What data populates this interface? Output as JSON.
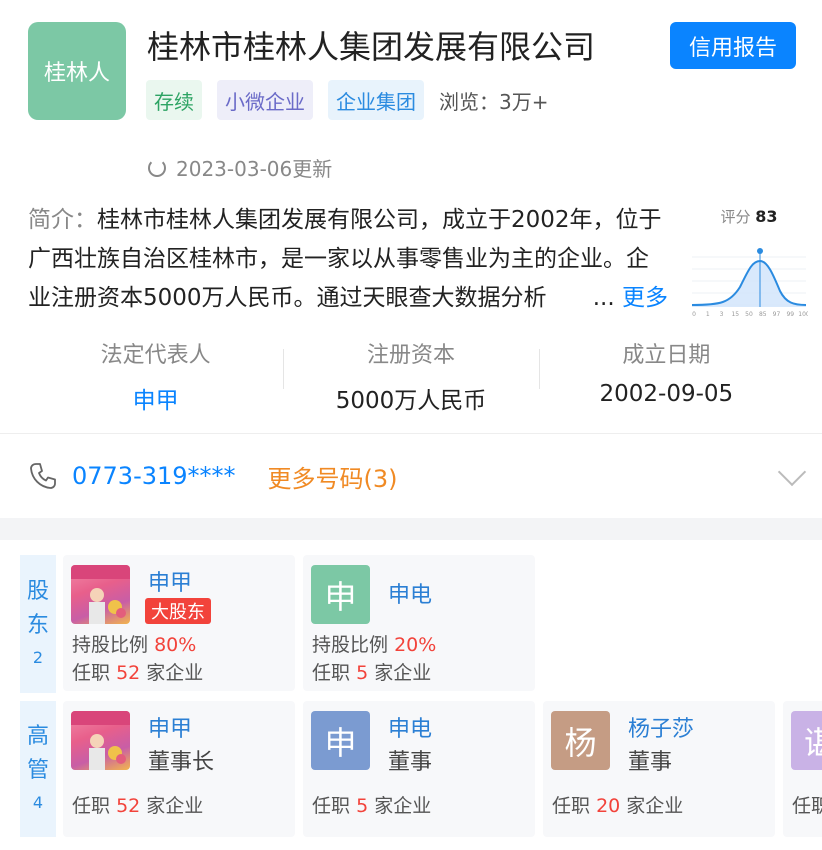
{
  "company": {
    "logo_text": "桂林人",
    "name": "桂林市桂林人集团发展有限公司",
    "report_button": "信用报告",
    "tags": [
      "存续",
      "小微企业",
      "企业集团"
    ],
    "views_label": "浏览：3万+",
    "updated": "2023-03-06更新"
  },
  "intro": {
    "label": "简介：",
    "text": "桂林市桂林人集团发展有限公司，成立于2002年，位于广西壮族自治区桂林市，是一家以从事零售业为主的企业。企业注册资本5000万人民币。通过天眼查大数据分析",
    "ellipsis": "...",
    "more": "更多"
  },
  "score": {
    "label": "评分",
    "value": "83",
    "axis_ticks": [
      "0",
      "1",
      "3",
      "15",
      "50",
      "85",
      "97",
      "99",
      "100"
    ]
  },
  "stats": [
    {
      "label": "法定代表人",
      "value": "申甲"
    },
    {
      "label": "注册资本",
      "value": "5000万人民币"
    },
    {
      "label": "成立日期",
      "value": "2002-09-05"
    }
  ],
  "phone": {
    "number": "0773-319****",
    "more": "更多号码(3)"
  },
  "shareholders": {
    "label": [
      "股",
      "东"
    ],
    "count": "2",
    "items": [
      {
        "avatar": "",
        "name": "申甲",
        "badge": "大股东",
        "ratio_label": "持股比例",
        "ratio": "80%",
        "jobs_prefix": "任职",
        "jobs": "52",
        "jobs_suffix": "家企业"
      },
      {
        "avatar": "申",
        "name": "申电",
        "ratio_label": "持股比例",
        "ratio": "20%",
        "jobs_prefix": "任职",
        "jobs": "5",
        "jobs_suffix": "家企业"
      }
    ]
  },
  "executives": {
    "label": [
      "高",
      "管"
    ],
    "count": "4",
    "items": [
      {
        "avatar": "",
        "name": "申甲",
        "role": "董事长",
        "jobs_prefix": "任职",
        "jobs": "52",
        "jobs_suffix": "家企业"
      },
      {
        "avatar": "申",
        "name": "申电",
        "role": "董事",
        "jobs_prefix": "任职",
        "jobs": "5",
        "jobs_suffix": "家企业"
      },
      {
        "avatar": "杨",
        "name": "杨子莎",
        "role": "董事",
        "jobs_prefix": "任职",
        "jobs": "20",
        "jobs_suffix": "家企业"
      },
      {
        "avatar": "谌",
        "jobs_prefix": "任职"
      }
    ]
  },
  "colors": {
    "primary": "#0a84ff",
    "accent_orange": "#f08a24",
    "red": "#f2433b",
    "logo_green": "#7cc8a5"
  }
}
